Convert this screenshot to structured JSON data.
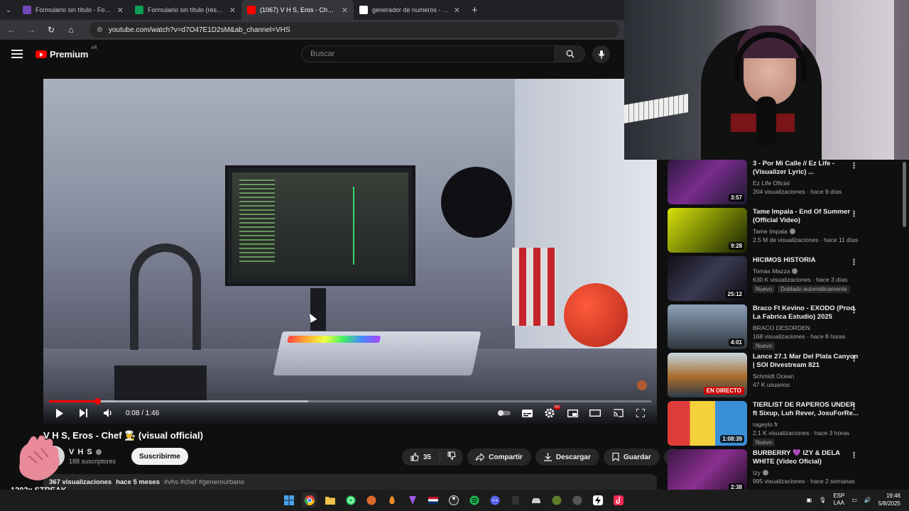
{
  "browser": {
    "tabs": [
      {
        "label": "Formulario sin título - Formulario",
        "favicon_color": "#7248b9",
        "active": false
      },
      {
        "label": "Formulario sin título (respuestas)",
        "favicon_color": "#0f9d58",
        "active": false
      },
      {
        "label": "(1067) V H S, Eros - Chef 👨‍🍳 (visual official)",
        "favicon_color": "#ff0000",
        "active": true
      },
      {
        "label": "generador de numeros - Buscar con Google",
        "favicon_color": "#ffffff",
        "active": false
      }
    ],
    "new_tab": "+",
    "url": "youtube.com/watch?v=d7O47E1D2sM&ab_channel=VHS"
  },
  "youtube": {
    "logo_text": "Premium",
    "region": "AR",
    "search_placeholder": "Buscar"
  },
  "player": {
    "current_time": "0:08 / 1:46",
    "played_fraction": 0.08,
    "buffered_fraction": 0.43,
    "toggle_badge": "HD"
  },
  "video": {
    "title": "V H S, Eros - Chef 👨‍🍳 (visual official)",
    "channel": "V H S",
    "subscribers": "188 suscriptores",
    "subscribe_label": "Suscribirme",
    "likes": "35",
    "share_label": "Compartir",
    "download_label": "Descargar",
    "save_label": "Guardar",
    "views": "367 visualizaciones",
    "age": "hace 5 meses",
    "tags": "#vhs #chef #generourbano"
  },
  "overlay": {
    "streak": "1202x STREAK"
  },
  "recommendations": [
    {
      "title": "3 - Por Mi Calle // Ez Life - (Visualizer Lyric) ...",
      "channel": "Ez Life Oficial",
      "verified": false,
      "stats": "204 visualizaciones · hace 9 días",
      "duration": "3:57",
      "live": false,
      "badges": [],
      "thumb": "linear-gradient(135deg,#2d1a3f,#7a2b8f 45%,#1b1b2b)"
    },
    {
      "title": "Tame Impala - End Of Summer (Official Video)",
      "channel": "Tame Impala",
      "verified": true,
      "stats": "2,5 M de visualizaciones · hace 11 días",
      "duration": "9:28",
      "live": false,
      "badges": [],
      "thumb": "linear-gradient(135deg,#d8e20a,#6b7a05 55%,#1a1d05)"
    },
    {
      "title": "HICIMOS HISTORIA",
      "channel": "Tomas Mazza",
      "verified": true,
      "stats": "630 K visualizaciones · hace 3 días",
      "duration": "25:12",
      "live": false,
      "badges": [
        "Nuevo",
        "Doblado automáticamente"
      ],
      "thumb": "linear-gradient(135deg,#101018,#3a3a52 50%,#0d0d12)"
    },
    {
      "title": "Braco Ft Kevino - EXODO (Prod. La Fabrica Estudio) 2025",
      "channel": "BRACO DESORDEN",
      "verified": false,
      "stats": "168 visualizaciones · hace 8 horas",
      "duration": "4:01",
      "live": false,
      "badges": [
        "Nuevo"
      ],
      "thumb": "linear-gradient(180deg,#8fa3b8,#5b6a7a 50%,#30363d)"
    },
    {
      "title": "Lance 27.1 Mar Del Plata Canyon | SOI Divestream 821",
      "channel": "Schmidt Ocean",
      "verified": false,
      "stats": "47 K usuarios",
      "duration": "EN DIRECTO",
      "live": true,
      "badges": [],
      "thumb": "linear-gradient(180deg,#c7d6e0,#a76b2a 55%,#2c3b4a)"
    },
    {
      "title": "TIERLIST DE RAPEROS UNDER ft Sixup, Luh Rever, JosuForRe...",
      "channel": "rageylo fr",
      "verified": false,
      "stats": "2,1 K visualizaciones · hace 3 horas",
      "duration": "1:08:39",
      "live": false,
      "badges": [
        "Nuevo"
      ],
      "thumb": "linear-gradient(90deg,#e03b3b 0 28%,#f2d13a 28% 60%,#3a8fd9 60%)"
    },
    {
      "title": "BURBERRY 💜 IZY & DELA WHITE (Video Oficial)",
      "channel": "Izy",
      "verified": true,
      "stats": "995 visualizaciones · hace 2 semanas",
      "duration": "2:38",
      "live": false,
      "badges": [],
      "thumb": "linear-gradient(135deg,#3a1844,#8a2f8f 50%,#1c0d22)"
    }
  ],
  "taskbar": {
    "lang_top": "ESP",
    "lang_bottom": "LAA",
    "time": "19:46",
    "date": "5/8/2025"
  }
}
